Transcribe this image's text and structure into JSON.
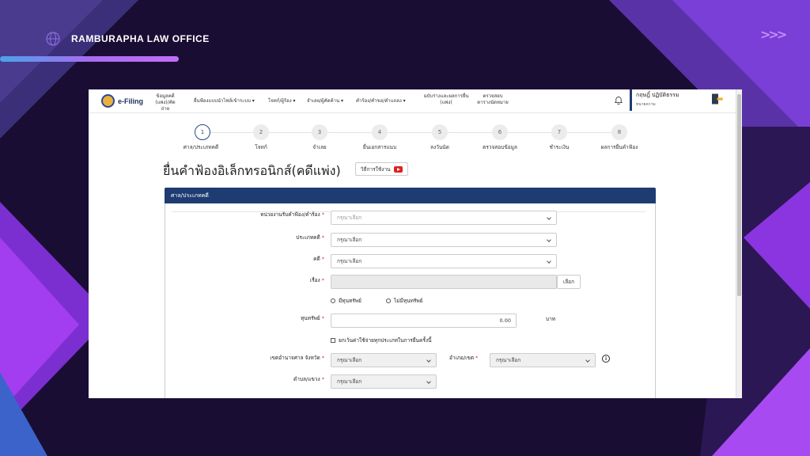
{
  "brand": {
    "name": "RAMBURAPHA LAW OFFICE",
    "icon": "globe-icon",
    "chevrons": ">>>"
  },
  "colors": {
    "background": "#1a0d33",
    "accent_purple": "#c26ef5",
    "nav_blue": "#1e3c72"
  },
  "app": {
    "logo_text": "e-Filing",
    "nav": [
      "ข้อมูลคดี (แพ่ง)/คัดถ่าย",
      "ยื่นฟ้องแบบนำไฟล์เข้าระบบ ▾",
      "โจทก์/ผู้ร้อง ▾",
      "จำเลย/ผู้คัดค้าน ▾",
      "คำร้อง/คำขอ/คำแถลง ▾",
      "ฉบับร่างและผลการยื่น (แพ่ง)",
      "ตรวจสอบ ตารางนัดหมาย"
    ],
    "user": {
      "name": "กฤษฎิ์ ปฏิบัติธรรม",
      "role": "ทนายความ"
    }
  },
  "steps": [
    {
      "num": "1",
      "label": "ศาล/ประเภทคดี"
    },
    {
      "num": "2",
      "label": "โจทก์"
    },
    {
      "num": "3",
      "label": "จำเลย"
    },
    {
      "num": "4",
      "label": "ยื่นเอกสารแนบ"
    },
    {
      "num": "5",
      "label": "ลงวันนัด"
    },
    {
      "num": "6",
      "label": "ตรวจสอบข้อมูล"
    },
    {
      "num": "7",
      "label": "ชำระเงิน"
    },
    {
      "num": "8",
      "label": "ผลการยื่นคำฟ้อง"
    }
  ],
  "page": {
    "title": "ยื่นคำฟ้องอิเล็กทรอนิกส์(คดีแพ่ง)",
    "how_to": "วิธีการใช้งาน"
  },
  "form": {
    "section": "ศาล/ประเภทคดี",
    "placeholder": "กรุณาเลือก",
    "agency_label": "หน่วยงานรับคำฟ้อง/คำร้อง",
    "case_type_label": "ประเภทคดี",
    "case_label": "คดี",
    "subject_label": "เรื่อง",
    "choose": "เลือก",
    "radio_asset": "มีทุนทรัพย์",
    "radio_no_asset": "ไม่มีทุนทรัพย์",
    "capital_label": "ทุนทรัพย์",
    "capital_value": "0.00",
    "unit": "บาท",
    "exempt_label": "ยกเว้นค่าใช้จ่ายทุกประเภทในการยื่นครั้งนี้",
    "province_label": "เขตอำนาจศาล จังหวัด",
    "district_label": "อำเภอ/เขต",
    "subdistrict_label": "ตำบล/แขวง",
    "required": "*"
  }
}
